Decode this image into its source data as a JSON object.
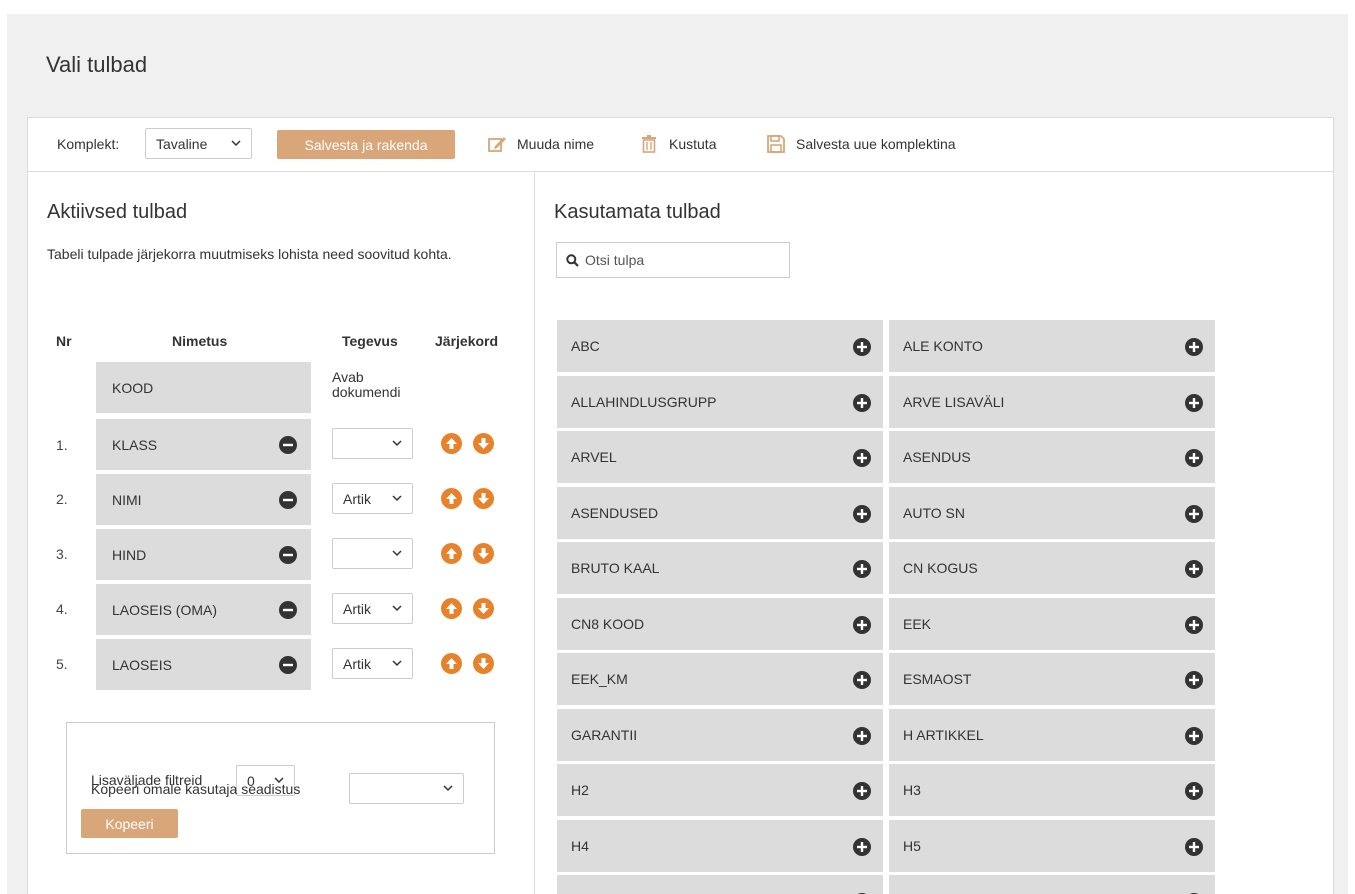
{
  "page": {
    "title": "Vali tulbad"
  },
  "toolbar": {
    "komplekt_label": "Komplekt:",
    "komplekt_value": "Tavaline",
    "save_apply_label": "Salvesta ja rakenda",
    "rename_label": "Muuda nime",
    "delete_label": "Kustuta",
    "save_new_label": "Salvesta uue komplektina"
  },
  "active": {
    "title": "Aktiivsed tulbad",
    "description": "Tabeli tulpade järjekorra muutmiseks lohista need soovitud kohta.",
    "headers": {
      "nr": "Nr",
      "name": "Nimetus",
      "action": "Tegevus",
      "order": "Järjekord"
    },
    "fixed_row": {
      "name": "KOOD",
      "action_text": "Avab dokumendi"
    },
    "rows": [
      {
        "nr": "1.",
        "name": "KLASS",
        "action": ""
      },
      {
        "nr": "2.",
        "name": "NIMI",
        "action": "Artik"
      },
      {
        "nr": "3.",
        "name": "HIND",
        "action": ""
      },
      {
        "nr": "4.",
        "name": "LAOSEIS (OMA)",
        "action": "Artik"
      },
      {
        "nr": "5.",
        "name": "LAOSEIS",
        "action": "Artik"
      }
    ],
    "bottom": {
      "filters_label": "Lisaväljade filtreid",
      "filters_value": "0",
      "copy_label": "Kopeeri omale kasutaja seadistus",
      "copy_value": "",
      "copy_button": "Kopeeri"
    }
  },
  "unused": {
    "title": "Kasutamata tulbad",
    "search_placeholder": "Otsi tulpa",
    "items": [
      "ABC",
      "ALE KONTO",
      "ALLAHINDLUSGRUPP",
      "ARVE LISAVÄLI",
      "ARVEL",
      "ASENDUS",
      "ASENDUSED",
      "AUTO SN",
      "BRUTO KAAL",
      "CN KOGUS",
      "CN8 KOOD",
      "EEK",
      "EEK_KM",
      "ESMAOST",
      "GARANTII",
      "H ARTIKKEL",
      "H2",
      "H3",
      "H4",
      "H5",
      "",
      ""
    ]
  },
  "colors": {
    "accent": "#d8a678",
    "button_orange": "#e8822a",
    "cell_gray": "#dcdcdc",
    "icon_dark": "#333333"
  }
}
